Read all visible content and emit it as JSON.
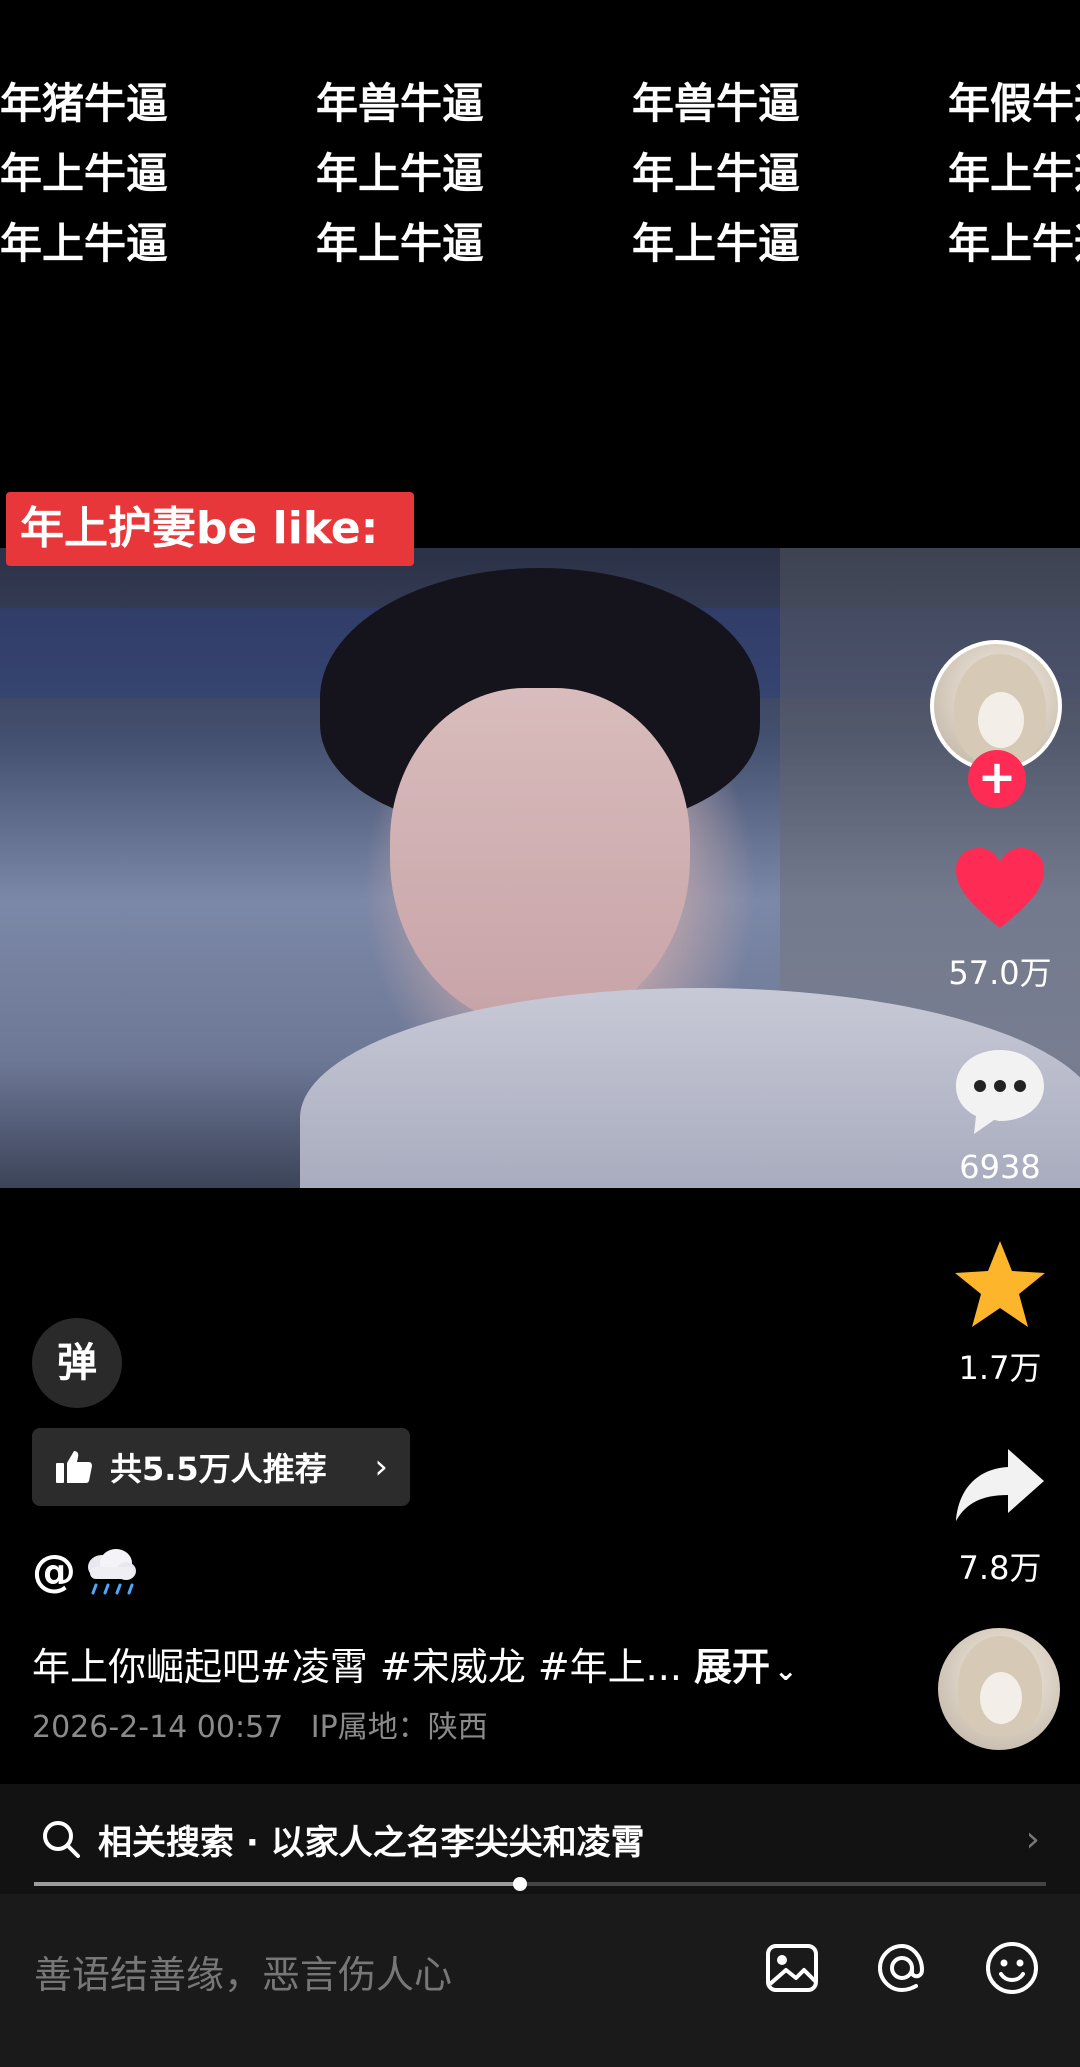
{
  "danmaku": {
    "rows": [
      [
        "年猪牛逼",
        "年兽牛逼",
        "年兽牛逼",
        "年假牛逼"
      ],
      [
        "年上牛逼",
        "年上牛逼",
        "年上牛逼",
        "年上牛逼"
      ],
      [
        "年上牛逼",
        "年上牛逼",
        "年上牛逼",
        "年上牛逼"
      ]
    ]
  },
  "video": {
    "caption_tag": "年上护妻be like:"
  },
  "actions": {
    "follow_label": "+",
    "likes": "57.0万",
    "comments": "6938",
    "favorites": "1.7万",
    "shares": "7.8万"
  },
  "danmu_toggle_label": "弹",
  "recommend": {
    "label": "共5.5万人推荐",
    "chevron": "›"
  },
  "post": {
    "author_prefix": "@",
    "description": "年上你崛起吧#凌霄 #宋威龙 #年上...",
    "expand_label": "展开",
    "date": "2026-2-14 00:57",
    "ip_location": "IP属地：陕西"
  },
  "related_search": {
    "label": "相关搜索 · 以家人之名李尖尖和凌霄",
    "arrow": "›"
  },
  "playback": {
    "progress": 0.48
  },
  "comment_input": {
    "placeholder": "善语结善缘，恶言伤人心"
  },
  "colors": {
    "like": "#fe2c55",
    "favorite": "#fdb52c",
    "caption_tag_bg": "#e8373a"
  }
}
